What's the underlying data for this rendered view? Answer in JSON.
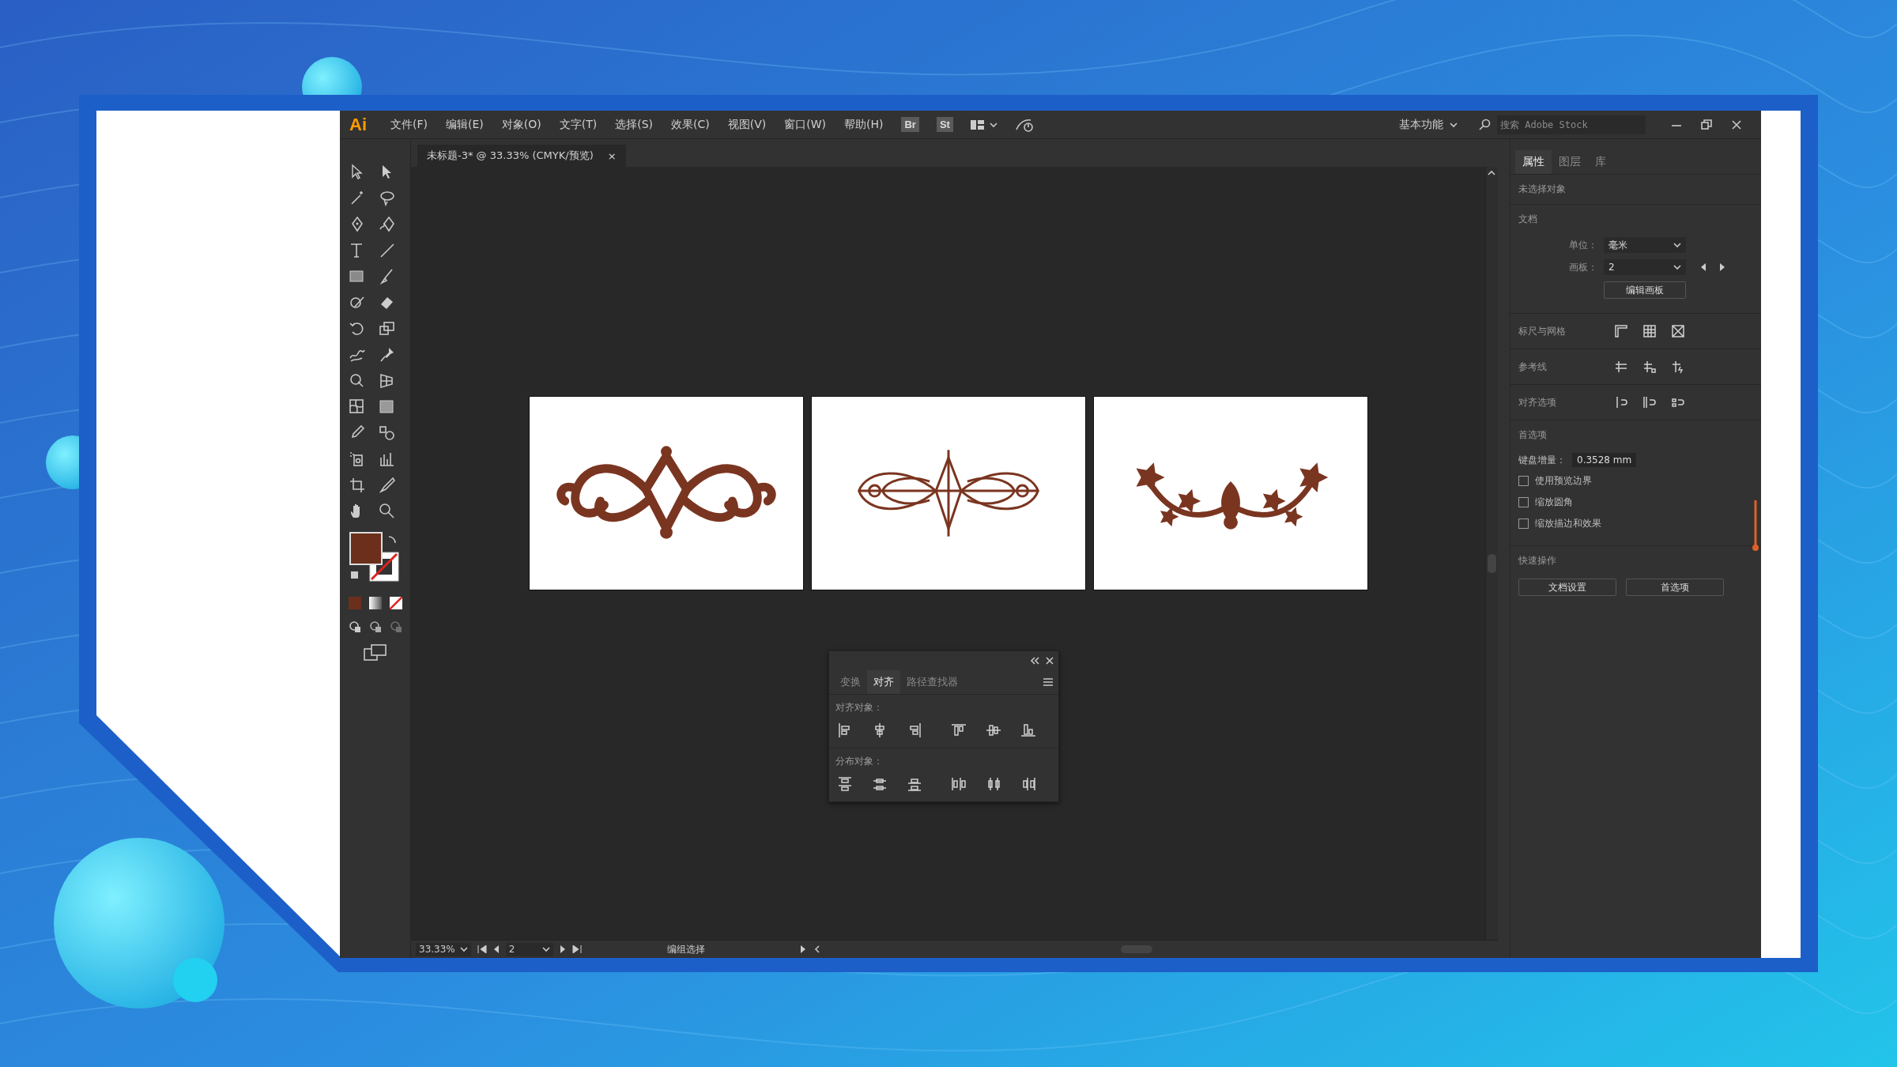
{
  "menu_bar": {
    "logo": "Ai",
    "menus": [
      "文件(F)",
      "编辑(E)",
      "对象(O)",
      "文字(T)",
      "选择(S)",
      "效果(C)",
      "视图(V)",
      "窗口(W)",
      "帮助(H)"
    ],
    "bridge": "Br",
    "stock": "St",
    "workspace": "基本功能",
    "search": {
      "placeholder": "搜索 Adobe Stock"
    }
  },
  "document_tab": {
    "title": "未标题-3* @ 33.33% (CMYK/预览)",
    "close": "×"
  },
  "artboards": [
    {
      "kind": "scroll"
    },
    {
      "kind": "lattice"
    },
    {
      "kind": "vine"
    }
  ],
  "align_panel": {
    "tabs": [
      {
        "label": "变换",
        "selected": false
      },
      {
        "label": "对齐",
        "selected": true
      },
      {
        "label": "路径查找器",
        "selected": false
      }
    ],
    "align_label": "对齐对象：",
    "distribute_label": "分布对象："
  },
  "properties_panel": {
    "tabs": [
      {
        "label": "属性",
        "selected": true
      },
      {
        "label": "图层",
        "selected": false
      },
      {
        "label": "库",
        "selected": false
      }
    ],
    "no_selection": "未选择对象",
    "document_heading": "文档",
    "unit_label": "单位：",
    "unit_value": "毫米",
    "artboard_label": "画板：",
    "artboard_value": "2",
    "edit_artboards": "编辑画板",
    "rulers_label": "标尺与网格",
    "guides_label": "参考线",
    "snap_label": "对齐选项",
    "preferences_heading": "首选项",
    "keyboard_increment_label": "键盘增量：",
    "keyboard_increment_value": "0.3528 mm",
    "checkboxes": [
      {
        "label": "使用预览边界",
        "checked": false
      },
      {
        "label": "缩放圆角",
        "checked": false
      },
      {
        "label": "缩放描边和效果",
        "checked": false
      }
    ],
    "quick_actions_heading": "快速操作",
    "quick_buttons": [
      "文档设置",
      "首选项"
    ]
  },
  "status_bar": {
    "zoom": "33.33%",
    "artboard": "2",
    "tool": "编组选择"
  }
}
